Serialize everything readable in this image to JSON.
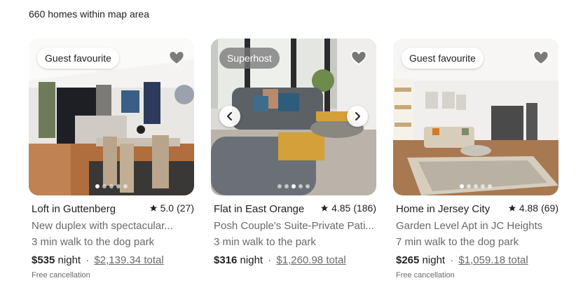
{
  "results": {
    "count_label": "660 homes within map area"
  },
  "listings": [
    {
      "badge": "Guest favourite",
      "title": "Loft in Guttenberg",
      "rating": "5.0",
      "reviews": "(27)",
      "description": "New duplex with spectacular...",
      "distance": "3 min walk to the dog park",
      "price": "$535",
      "per": "night",
      "sep": "·",
      "total": "$2,139.34 total",
      "cancellation": "Free cancellation",
      "dot_count": 5,
      "active_dot": 0
    },
    {
      "badge": "Superhost",
      "title": "Flat in East Orange",
      "rating": "4.85",
      "reviews": "(186)",
      "description": "Posh Couple's Suite-Private Pati...",
      "distance": "3 min walk to the park",
      "price": "$316",
      "per": "night",
      "sep": "·",
      "total": "$1,260.98 total",
      "cancellation": "",
      "dot_count": 5,
      "active_dot": 2
    },
    {
      "badge": "Guest favourite",
      "title": "Home in Jersey City",
      "rating": "4.88",
      "reviews": "(69)",
      "description": "Garden Level Apt in JC Heights",
      "distance": "7 min walk to the dog park",
      "price": "$265",
      "per": "night",
      "sep": "·",
      "total": "$1,059.18 total",
      "cancellation": "Free cancellation",
      "dot_count": 5,
      "active_dot": 0
    }
  ],
  "icons": {
    "heart": "heart-icon",
    "star": "star-icon",
    "prev": "chevron-left-icon",
    "next": "chevron-right-icon"
  },
  "colors": {
    "text": "#222222",
    "muted": "#6a6a6a",
    "background": "#ffffff"
  }
}
